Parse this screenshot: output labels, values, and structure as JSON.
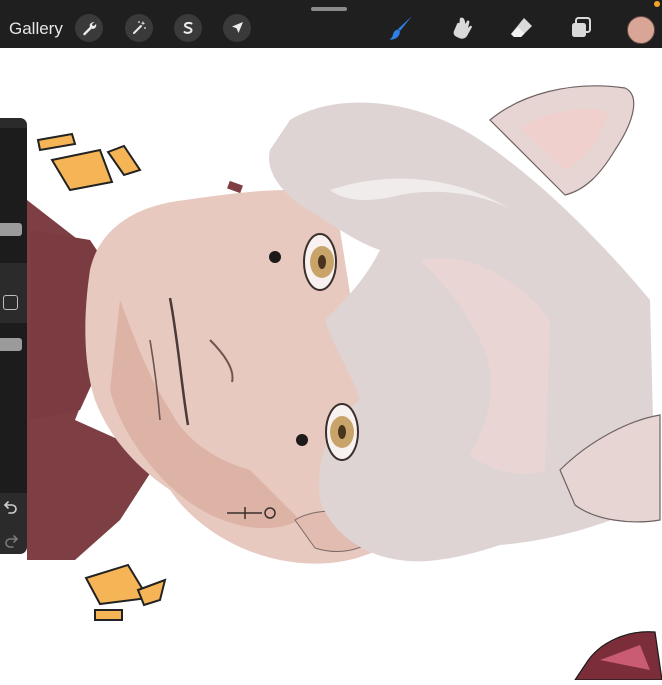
{
  "app": {
    "gallery_label": "Gallery"
  },
  "toolbar": {
    "left_tools": [
      "wrench-icon",
      "magic-wand-icon",
      "selection-s-icon",
      "transform-arrow-icon"
    ],
    "right_tools": [
      "brush-icon",
      "smudge-icon",
      "eraser-icon",
      "layers-icon"
    ],
    "active_tool": "brush-icon",
    "accent_color": "#2f7fe6",
    "current_color": "#d9a596"
  },
  "sidebar": {
    "size_slider_level": 0.26,
    "opacity_slider_level": 0.55,
    "undo_icon": "undo-icon",
    "redo_icon": "redo-icon"
  },
  "colors": {
    "hair": "#ddd4d3",
    "skin": "#e8c9bf",
    "shirt": "#7d3f43",
    "accent_orange": "#f5b456",
    "eye": "#c9a46a"
  }
}
